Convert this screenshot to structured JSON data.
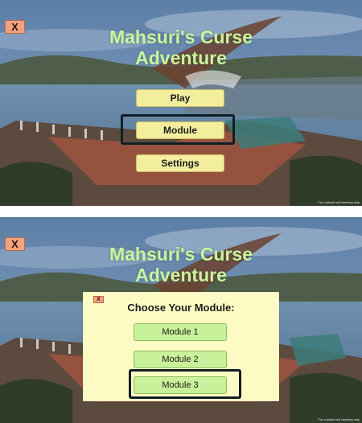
{
  "screen_main": {
    "close_label": "X",
    "title_line1": "Mahsuri's Curse",
    "title_line2": "Adventure",
    "menu": {
      "play": "Play",
      "module": "Module",
      "settings": "Settings"
    },
    "watermark": "For cultural and learning only"
  },
  "screen_module": {
    "close_label": "X",
    "title_line1": "Mahsuri's Curse",
    "title_line2": "Adventure",
    "dialog": {
      "close_label": "X",
      "heading": "Choose Your Module:",
      "modules": [
        "Module 1",
        "Module 2",
        "Module 3"
      ]
    },
    "watermark": "For cultural and learning only"
  },
  "colors": {
    "title": "#c9f59c",
    "menu_button": "#f3ee9e",
    "module_button": "#c9f09a",
    "dialog_bg": "#fdfbc4",
    "close_button": "#f2a27e",
    "highlight": "#0f1f26"
  }
}
